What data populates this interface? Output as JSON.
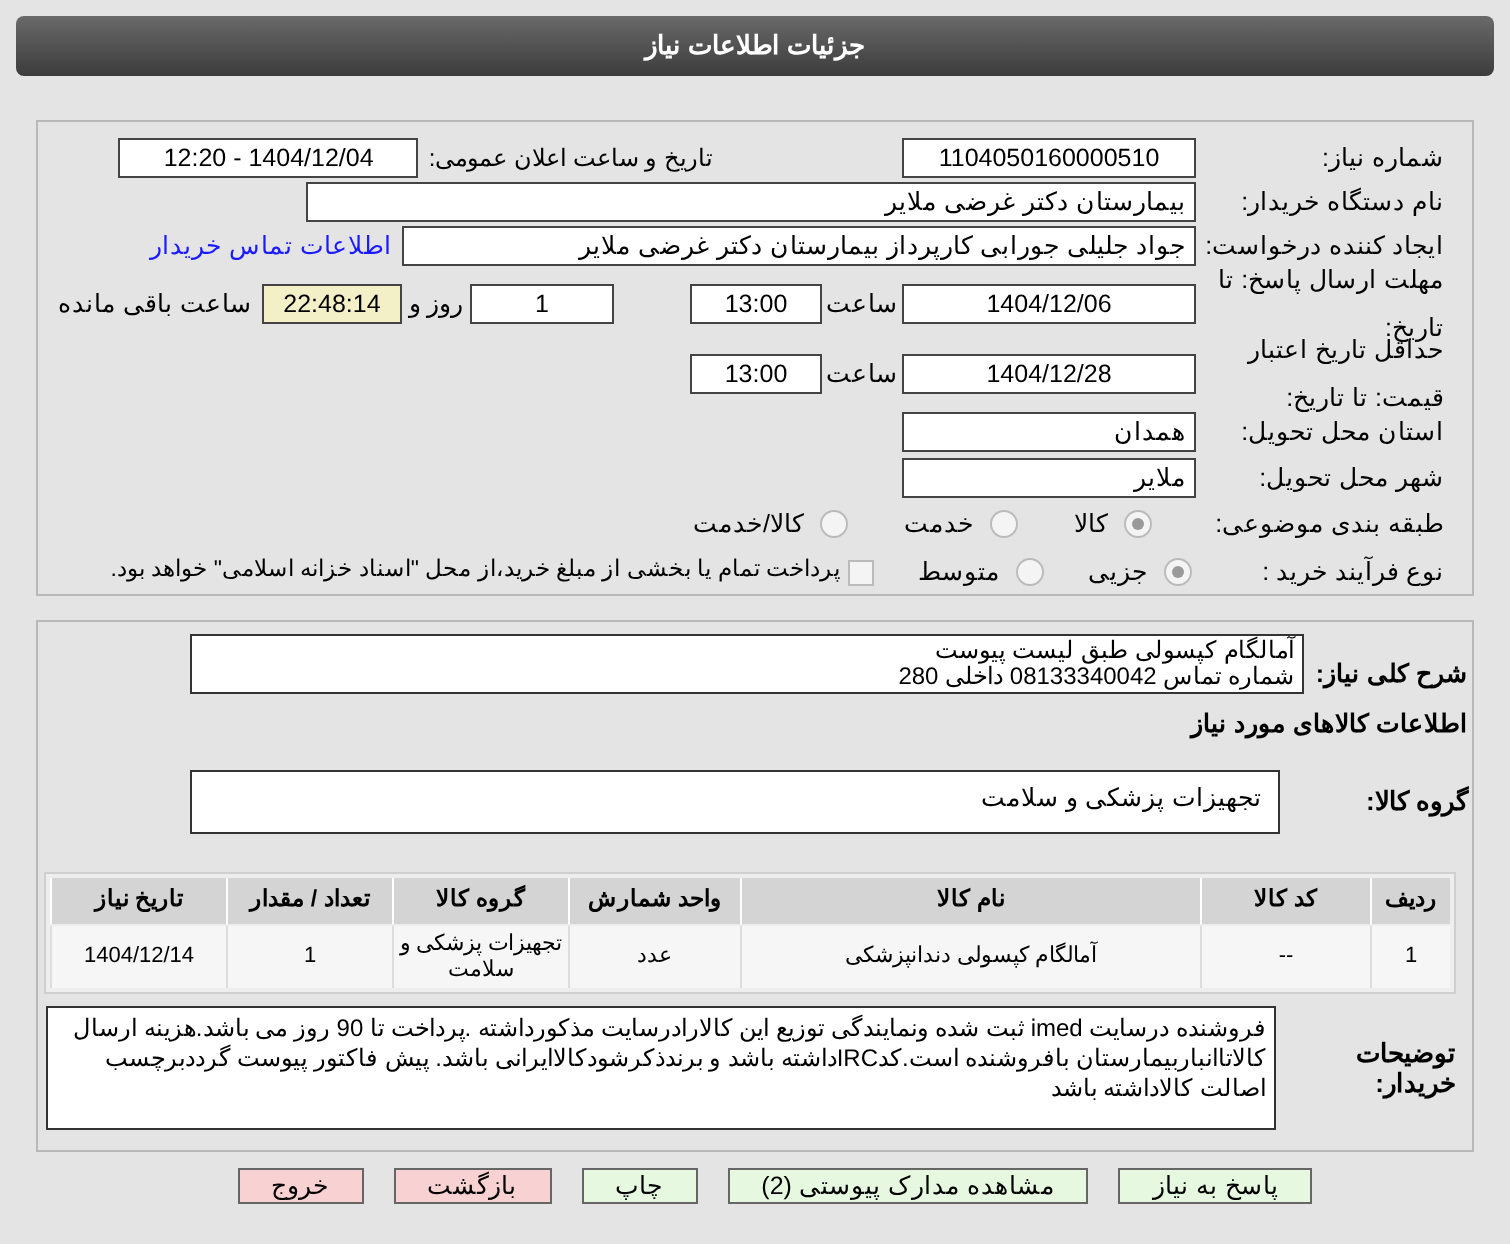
{
  "header": {
    "title": "جزئیات اطلاعات نیاز"
  },
  "need_number": {
    "label": "شماره نیاز:",
    "value": "1104050160000510"
  },
  "announce": {
    "label": "تاریخ و ساعت اعلان عمومی:",
    "value": "1404/12/04 - 12:20"
  },
  "buyer": {
    "label": "نام دستگاه خریدار:",
    "value": "بیمارستان دکتر غرضی ملایر"
  },
  "creator": {
    "label": "ایجاد کننده درخواست:",
    "value": "جواد جلیلی جورابی کارپرداز بیمارستان دکتر غرضی ملایر",
    "link": "اطلاعات تماس خریدار"
  },
  "reply_deadline": {
    "label": "مهلت ارسال پاسخ: تا تاریخ:",
    "date": "1404/12/06",
    "time_label": "ساعت",
    "time": "13:00",
    "days": "1",
    "days_label": "روز و",
    "remaining": "22:48:14",
    "remaining_label": "ساعت باقی مانده"
  },
  "price_validity": {
    "label": "حداقل تاریخ اعتبار قیمت: تا تاریخ:",
    "date": "1404/12/28",
    "time_label": "ساعت",
    "time": "13:00"
  },
  "province": {
    "label": "استان محل تحویل:",
    "value": "همدان"
  },
  "city": {
    "label": "شهر محل تحویل:",
    "value": "ملایر"
  },
  "category": {
    "label": "طبقه بندی موضوعی:",
    "options": [
      {
        "label": "کالا",
        "selected": true
      },
      {
        "label": "خدمت",
        "selected": false
      },
      {
        "label": "کالا/خدمت",
        "selected": false
      }
    ]
  },
  "purchase_type": {
    "label": "نوع فرآیند خرید :",
    "options": [
      {
        "label": "جزیی",
        "selected": true
      },
      {
        "label": "متوسط",
        "selected": false
      }
    ],
    "payment": {
      "label": "پرداخت تمام یا بخشی از مبلغ خرید،از محل \"اسناد خزانه اسلامی\" خواهد بود.",
      "checked": false
    }
  },
  "description": {
    "label": "شرح کلی نیاز:",
    "lines": [
      "آمالگام کپسولی طبق لیست پیوست",
      "شماره تماس 08133340042 داخلی 280"
    ]
  },
  "goods_title": "اطلاعات کالاهای مورد نیاز",
  "goods_group": {
    "label": "گروه کالا:",
    "value": "تجهیزات پزشکی و سلامت"
  },
  "table": {
    "columns": [
      "ردیف",
      "کد کالا",
      "نام کالا",
      "واحد شمارش",
      "گروه کالا",
      "تعداد / مقدار",
      "تاریخ نیاز"
    ],
    "rows": [
      [
        "1",
        "--",
        "آمالگام کپسولی دندانپزشکی",
        "عدد",
        "تجهیزات پزشکی و سلامت",
        "1",
        "1404/12/14"
      ]
    ]
  },
  "buyer_notes": {
    "label": "توضیحات خریدار:",
    "text": "فروشنده درسایت imed ثبت شده ونمایندگی توزیع این کالارادرسایت مذکورداشته .پرداخت تا  90 روز می باشد.هزینه ارسال کالاتاانباربیمارستان بافروشنده است.کدIRCداشته باشد و برندذکرشودکالاایرانی باشد. پیش فاکتور پیوست گرددبرچسب اصالت کالاداشته باشد"
  },
  "buttons": [
    {
      "label": "پاسخ به نیاز",
      "kind": "normal"
    },
    {
      "label": "مشاهده مدارک پیوستی (2)",
      "kind": "normal"
    },
    {
      "label": "چاپ",
      "kind": "normal"
    },
    {
      "label": "بازگشت",
      "kind": "danger"
    },
    {
      "label": "خروج",
      "kind": "danger"
    }
  ]
}
